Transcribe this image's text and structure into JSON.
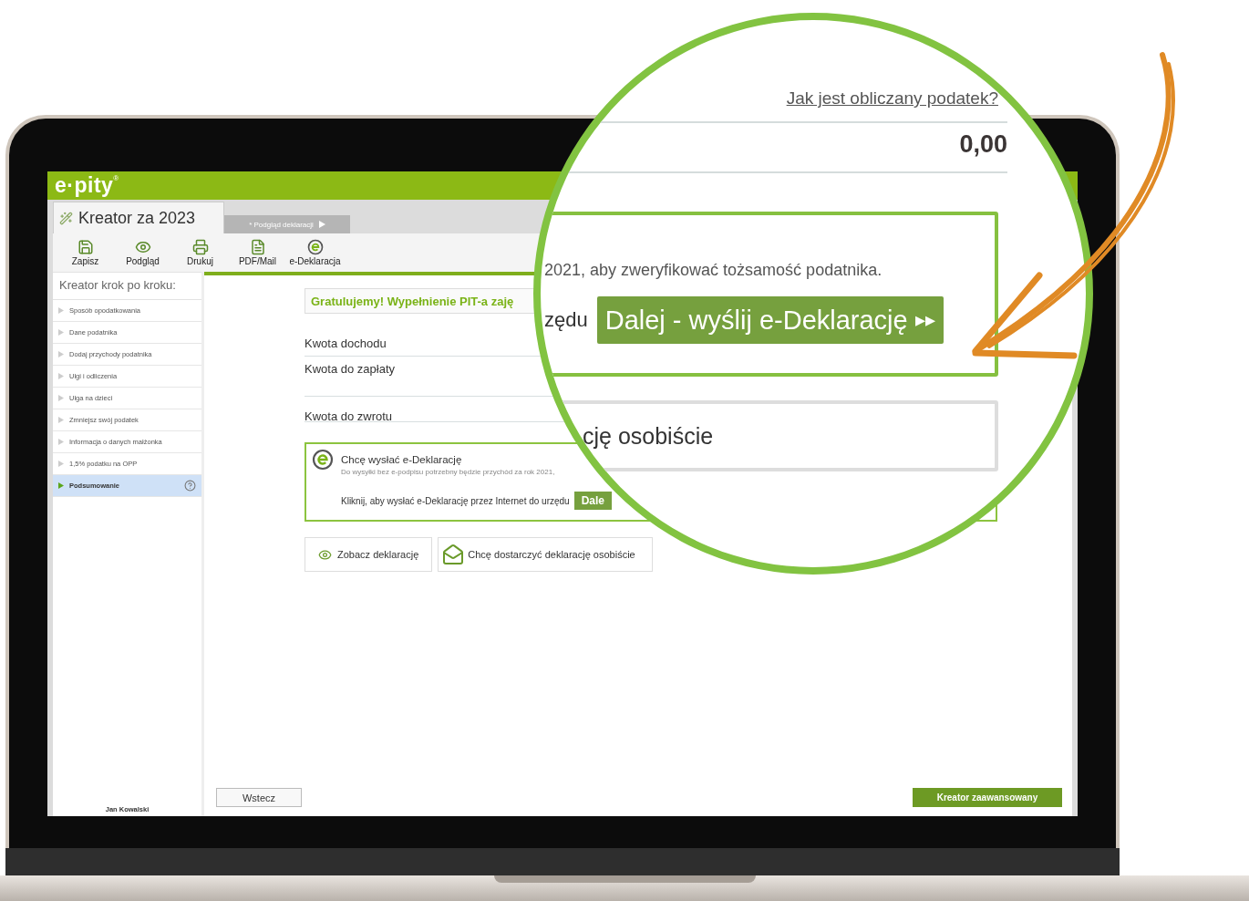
{
  "app": {
    "logo": "e·pity",
    "logo_mark": "®"
  },
  "tabs": [
    {
      "label": "Kreator za 2023",
      "selected": true
    },
    {
      "label": "* Podgląd deklaracji",
      "selected": false
    }
  ],
  "toolbar": [
    {
      "label": "Zapisz",
      "kind": "save"
    },
    {
      "label": "Podgląd",
      "kind": "preview"
    },
    {
      "label": "Drukuj",
      "kind": "print"
    },
    {
      "label": "PDF/Mail",
      "kind": "pdf"
    },
    {
      "label": "e-Deklaracja",
      "kind": "edeclaration"
    }
  ],
  "sidebar": {
    "title": "Kreator krok po kroku:",
    "items": [
      {
        "label": "Sposób opodatkowania",
        "selected": false
      },
      {
        "label": "Dane podatnika",
        "selected": false
      },
      {
        "label": "Dodaj przychody podatnika",
        "selected": false
      },
      {
        "label": "Ulgi i odliczenia",
        "selected": false
      },
      {
        "label": "Ulga na dzieci",
        "selected": false
      },
      {
        "label": "Zmniejsz swój podatek",
        "selected": false
      },
      {
        "label": "Informacja o danych małżonka",
        "selected": false
      },
      {
        "label": "1,5% podatku na OPP",
        "selected": false
      },
      {
        "label": "Podsumowanie",
        "selected": true
      }
    ],
    "user": "Jan Kowalski"
  },
  "summary": {
    "congrats": "Gratulujemy! Wypełnienie PIT-a zaję",
    "rows": [
      {
        "label": "Kwota dochodu"
      },
      {
        "label": "Kwota do zapłaty"
      },
      {
        "label": "Kwota do zwrotu"
      }
    ]
  },
  "edeclaration": {
    "title": "Chcę wysłać e-Deklarację",
    "note": "Do wysyłki bez e-podpisu potrzebny będzie przychód za rok 2021,",
    "prompt": "Kliknij, aby wysłać e-Deklarację przez Internet do urzędu",
    "button": "Dale"
  },
  "actions": [
    {
      "label": "Zobacz deklarację",
      "kind": "view"
    },
    {
      "label": "Chcę dostarczyć deklarację osobiście",
      "kind": "deliver"
    }
  ],
  "footer": {
    "back": "Wstecz",
    "advanced": "Kreator zaawansowany"
  },
  "magnifier": {
    "link": "Jak jest obliczany podatek?",
    "amount": "0,00",
    "note": "2021, aby zweryfikować tożsamość podatnika.",
    "prompt": "zędu",
    "button": "Dalej - wyślij e-Deklarację",
    "button_arrows": "▸▸",
    "option": "cję osobiście"
  }
}
